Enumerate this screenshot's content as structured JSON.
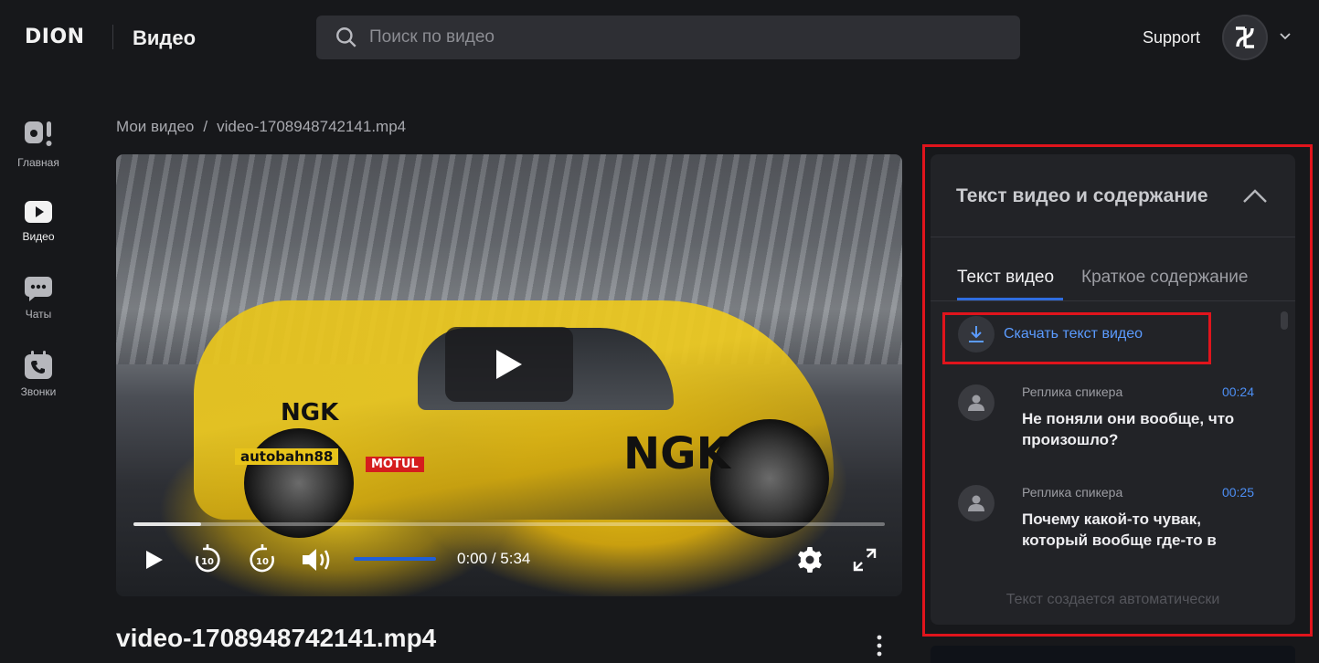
{
  "header": {
    "logo": "DION",
    "app_title": "Видео",
    "search_placeholder": "Поиск по видео",
    "support_label": "Support"
  },
  "sidebar": {
    "items": [
      {
        "label": "Главная",
        "icon": "home-icon"
      },
      {
        "label": "Видео",
        "icon": "video-icon",
        "active": true
      },
      {
        "label": "Чаты",
        "icon": "chat-icon"
      },
      {
        "label": "Звонки",
        "icon": "calls-icon"
      }
    ]
  },
  "breadcrumb": {
    "root": "Мои видео",
    "separator": "/",
    "current": "video-1708948742141.mp4"
  },
  "player": {
    "current_time": "0:00",
    "time_separator": "/",
    "duration": "5:34",
    "progress_fraction": 0.09,
    "volume_fraction": 1.0,
    "rewind_label": "10",
    "forward_label": "10"
  },
  "video_title": "video-1708948742141.mp4",
  "panel": {
    "title": "Текст видео и содержание",
    "tabs": [
      {
        "label": "Текст видео",
        "active": true
      },
      {
        "label": "Краткое содержание",
        "active": false
      }
    ],
    "download_label": "Скачать текст видео",
    "replies": [
      {
        "speaker": "Реплика спикера",
        "time": "00:24",
        "text": "Не поняли они вообще, что произошло?"
      },
      {
        "speaker": "Реплика спикера",
        "time": "00:25",
        "text": "Почему какой-то чувак, который вообще где-то в"
      }
    ],
    "footer_note": "Текст создается автоматически"
  },
  "colors": {
    "accent": "#2f6de0",
    "link": "#5b9bff",
    "highlight": "#e0141c",
    "background": "#17181b"
  }
}
